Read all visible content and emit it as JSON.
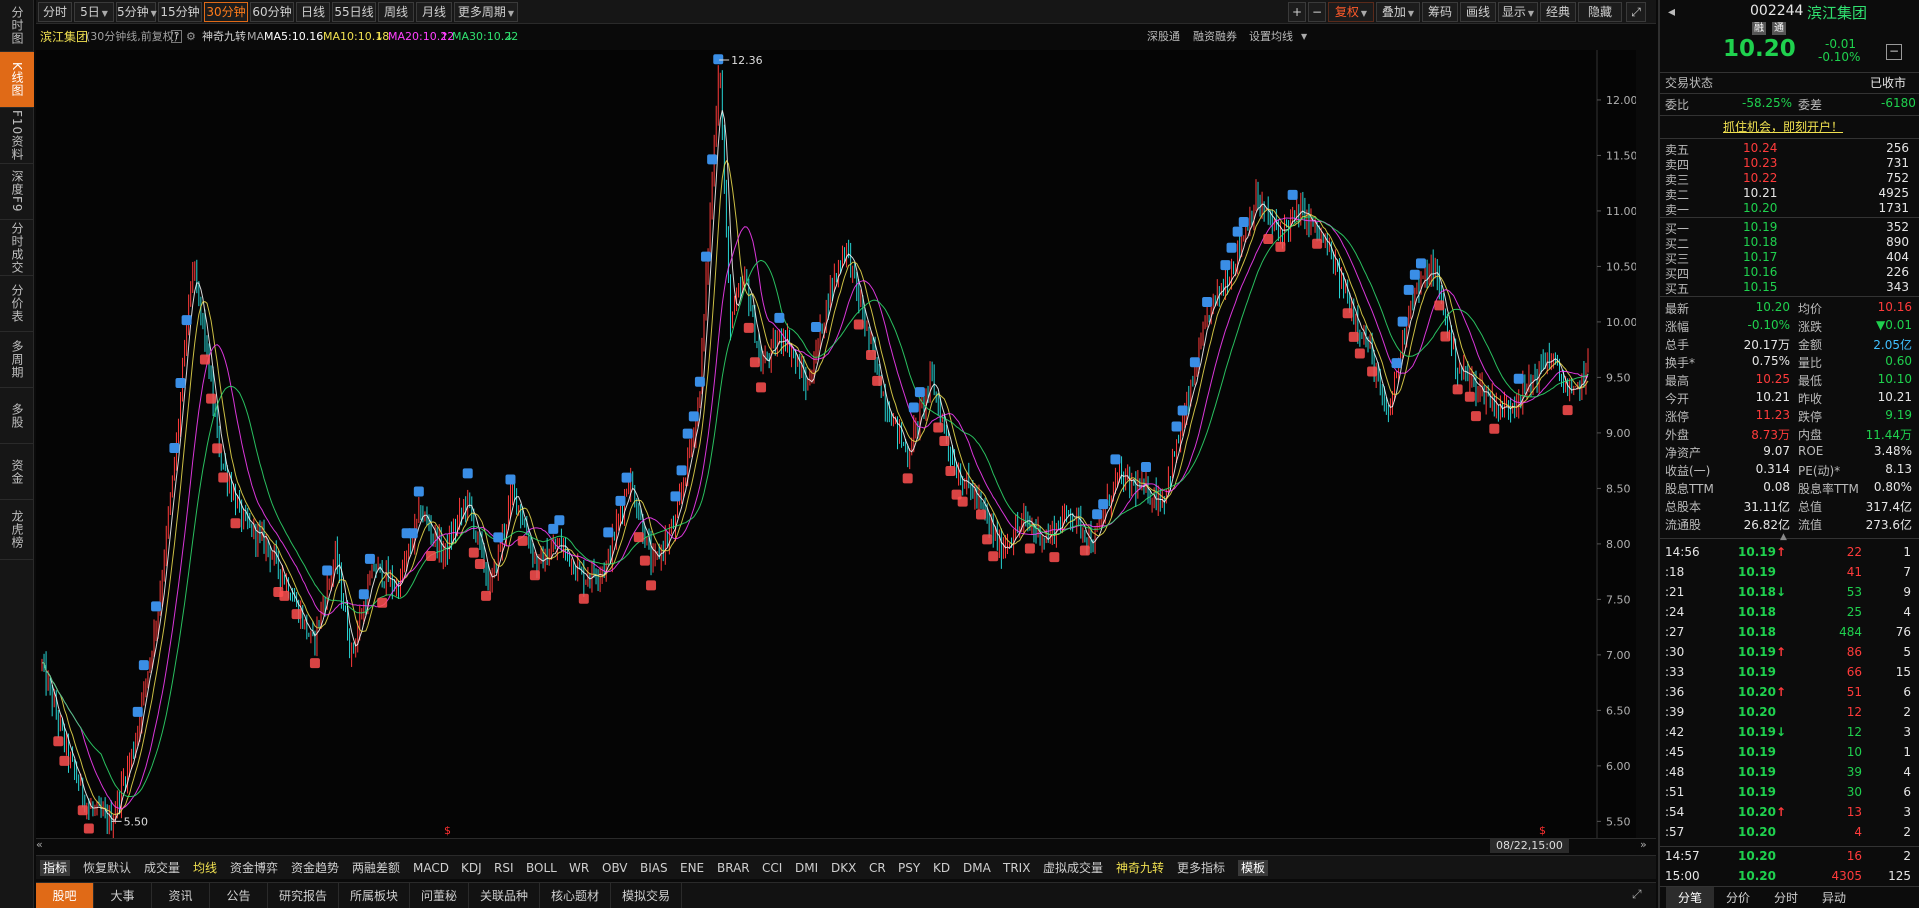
{
  "left_tabs": [
    {
      "label": "分时图",
      "active": false
    },
    {
      "label": "K线图",
      "active": true
    },
    {
      "label": "F10资料",
      "active": false
    },
    {
      "label": "深度F9",
      "active": false
    },
    {
      "label": "分时成交",
      "active": false
    },
    {
      "label": "分价表",
      "active": false
    },
    {
      "label": "多周期",
      "active": false
    },
    {
      "label": "多股",
      "active": false
    },
    {
      "label": "资金",
      "active": false
    },
    {
      "label": "龙虎榜",
      "active": false
    }
  ],
  "toolbar": {
    "periods": [
      "分时",
      "5日",
      "5分钟",
      "15分钟",
      "30分钟",
      "60分钟",
      "日线",
      "55日线",
      "周线",
      "月线",
      "更多周期"
    ],
    "active_period": "30分钟",
    "right_buttons": [
      "+",
      "−",
      "复权",
      "叠加",
      "筹码",
      "画线",
      "显示",
      "经典",
      "隐藏"
    ],
    "active_right": "复权"
  },
  "info": {
    "name": "滨江集团",
    "mode": "(30分钟线,前复权)",
    "help": "?",
    "indicator": "神奇九转",
    "ma_label": "MA",
    "ma5": "MA5:10.16",
    "ma10": "MA10:10.18",
    "ma20": "MA20:10.22",
    "ma30": "MA30:10.22",
    "right_links": [
      "深股通",
      "融资融券",
      "设置均线"
    ],
    "colors": {
      "ma5": "#ffffff",
      "ma10": "#f0e050",
      "ma20": "#ff40ff",
      "ma30": "#30e070"
    }
  },
  "chart_data": {
    "type": "candlestick",
    "y_ticks": [
      12.0,
      11.5,
      11.0,
      10.5,
      10.0,
      9.5,
      9.0,
      8.5,
      8.0,
      7.5,
      7.0,
      6.5,
      6.0,
      5.5
    ],
    "ylim": [
      5.35,
      12.45
    ],
    "max_label": "12.36",
    "min_label": "5.50",
    "x_cursor_label": "08/22,15:00",
    "colors": {
      "up": "#ff3b3b",
      "down": "#27d4d4",
      "buy": "#ff5050",
      "sell": "#3a8ee6"
    }
  },
  "indicators": [
    "指标",
    "恢复默认",
    "成交量",
    "均线",
    "资金博弈",
    "资金趋势",
    "两融差额",
    "MACD",
    "KDJ",
    "RSI",
    "BOLL",
    "WR",
    "OBV",
    "BIAS",
    "ENE",
    "BRAR",
    "CCI",
    "DMI",
    "DKX",
    "CR",
    "PSY",
    "KD",
    "DMA",
    "TRIX",
    "虚拟成交量",
    "神奇九转",
    "更多指标",
    "模板"
  ],
  "nav": [
    "股吧",
    "大事",
    "资讯",
    "公告",
    "研究报告",
    "所属板块",
    "问董秘",
    "关联品种",
    "核心题材",
    "模拟交易"
  ],
  "quote": {
    "code": "002244",
    "name": "滨江集团",
    "tag1": "融",
    "tag2": "通",
    "price": "10.20",
    "change": "-0.01",
    "change_pct": "-0.10%",
    "status_label": "交易状态",
    "status": "已收市",
    "wb_label": "委比",
    "wb": "-58.25%",
    "wc_label": "委差",
    "wc": "-6180",
    "promo": "抓住机会，即刻开户！",
    "sell": [
      {
        "label": "卖五",
        "price": "10.24",
        "vol": "256"
      },
      {
        "label": "卖四",
        "price": "10.23",
        "vol": "731"
      },
      {
        "label": "卖三",
        "price": "10.22",
        "vol": "752"
      },
      {
        "label": "卖二",
        "price": "10.21",
        "vol": "4925"
      },
      {
        "label": "卖一",
        "price": "10.20",
        "vol": "1731"
      }
    ],
    "buy": [
      {
        "label": "买一",
        "price": "10.19",
        "vol": "352"
      },
      {
        "label": "买二",
        "price": "10.18",
        "vol": "890"
      },
      {
        "label": "买三",
        "price": "10.17",
        "vol": "404"
      },
      {
        "label": "买四",
        "price": "10.16",
        "vol": "226"
      },
      {
        "label": "买五",
        "price": "10.15",
        "vol": "343"
      }
    ],
    "stats": [
      {
        "l1": "最新",
        "v1": "10.20",
        "l2": "均价",
        "v2": "10.16",
        "c1": "green",
        "c2": "red"
      },
      {
        "l1": "涨幅",
        "v1": "-0.10%",
        "l2": "涨跌",
        "v2": "▼0.01",
        "c1": "green",
        "c2": "green"
      },
      {
        "l1": "总手",
        "v1": "20.17万",
        "l2": "金额",
        "v2": "2.05亿",
        "c1": "white",
        "c2": "cyan"
      },
      {
        "l1": "换手*",
        "v1": "0.75%",
        "l2": "量比",
        "v2": "0.60",
        "c1": "white",
        "c2": "green"
      },
      {
        "l1": "最高",
        "v1": "10.25",
        "l2": "最低",
        "v2": "10.10",
        "c1": "red",
        "c2": "green"
      },
      {
        "l1": "今开",
        "v1": "10.21",
        "l2": "昨收",
        "v2": "10.21",
        "c1": "white",
        "c2": "white"
      },
      {
        "l1": "涨停",
        "v1": "11.23",
        "l2": "跌停",
        "v2": "9.19",
        "c1": "red",
        "c2": "green"
      },
      {
        "l1": "外盘",
        "v1": "8.73万",
        "l2": "内盘",
        "v2": "11.44万",
        "c1": "red",
        "c2": "green"
      },
      {
        "l1": "净资产",
        "v1": "9.07",
        "l2": "ROE",
        "v2": "3.48%",
        "c1": "white",
        "c2": "white"
      },
      {
        "l1": "收益(一)",
        "v1": "0.314",
        "l2": "PE(动)*",
        "v2": "8.13",
        "c1": "white",
        "c2": "white"
      },
      {
        "l1": "股息TTM",
        "v1": "0.08",
        "l2": "股息率TTM",
        "v2": "0.80%",
        "c1": "white",
        "c2": "white"
      },
      {
        "l1": "总股本",
        "v1": "31.11亿",
        "l2": "总值",
        "v2": "317.4亿",
        "c1": "white",
        "c2": "white"
      },
      {
        "l1": "流通股",
        "v1": "26.82亿",
        "l2": "流值",
        "v2": "273.6亿",
        "c1": "white",
        "c2": "white"
      }
    ],
    "ticks": [
      {
        "t": "14:56",
        "p": "10.19",
        "a": "up",
        "v": "22",
        "n": "1",
        "vc": "red"
      },
      {
        "t": ":18",
        "p": "10.19",
        "a": "",
        "v": "41",
        "n": "7",
        "vc": "red"
      },
      {
        "t": ":21",
        "p": "10.18",
        "a": "down",
        "v": "53",
        "n": "9",
        "vc": "green"
      },
      {
        "t": ":24",
        "p": "10.18",
        "a": "",
        "v": "25",
        "n": "4",
        "vc": "green"
      },
      {
        "t": ":27",
        "p": "10.18",
        "a": "",
        "v": "484",
        "n": "76",
        "vc": "green"
      },
      {
        "t": ":30",
        "p": "10.19",
        "a": "up",
        "v": "86",
        "n": "5",
        "vc": "red"
      },
      {
        "t": ":33",
        "p": "10.19",
        "a": "",
        "v": "66",
        "n": "15",
        "vc": "red"
      },
      {
        "t": ":36",
        "p": "10.20",
        "a": "up",
        "v": "51",
        "n": "6",
        "vc": "red"
      },
      {
        "t": ":39",
        "p": "10.20",
        "a": "",
        "v": "12",
        "n": "2",
        "vc": "red"
      },
      {
        "t": ":42",
        "p": "10.19",
        "a": "down",
        "v": "12",
        "n": "3",
        "vc": "green"
      },
      {
        "t": ":45",
        "p": "10.19",
        "a": "",
        "v": "10",
        "n": "1",
        "vc": "green"
      },
      {
        "t": ":48",
        "p": "10.19",
        "a": "",
        "v": "39",
        "n": "4",
        "vc": "green"
      },
      {
        "t": ":51",
        "p": "10.19",
        "a": "",
        "v": "30",
        "n": "6",
        "vc": "green"
      },
      {
        "t": ":54",
        "p": "10.20",
        "a": "up",
        "v": "13",
        "n": "3",
        "vc": "red"
      },
      {
        "t": ":57",
        "p": "10.20",
        "a": "",
        "v": "4",
        "n": "2",
        "vc": "red"
      },
      {
        "t": "14:57",
        "p": "10.20",
        "a": "",
        "v": "16",
        "n": "2",
        "vc": "red"
      },
      {
        "t": "15:00",
        "p": "10.20",
        "a": "",
        "v": "4305",
        "n": "125",
        "vc": "red"
      }
    ],
    "bottom_tabs": [
      "分笔",
      "分价",
      "分时",
      "异动"
    ],
    "active_bottom": "分笔"
  }
}
